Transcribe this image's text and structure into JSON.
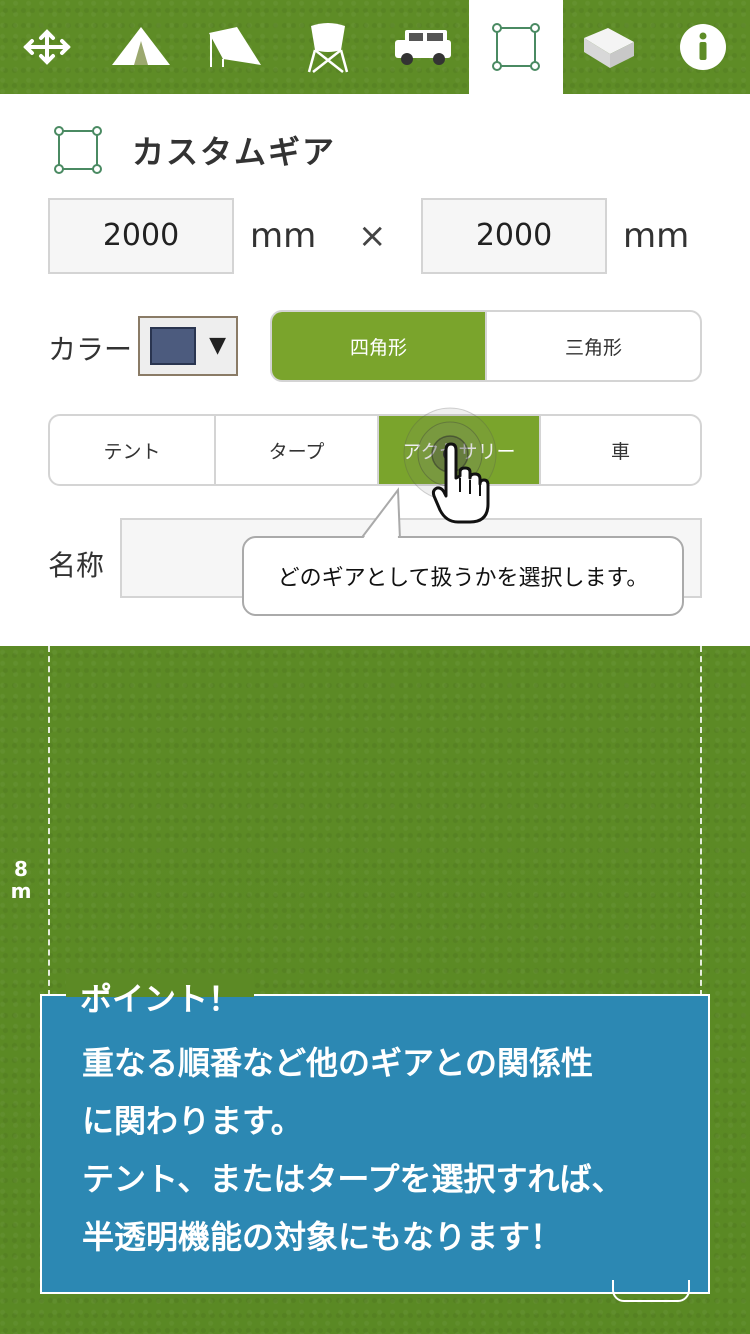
{
  "toolbar": {
    "items": [
      {
        "icon": "move-arrows-icon",
        "active": false
      },
      {
        "icon": "tent-icon",
        "active": false
      },
      {
        "icon": "tarp-icon",
        "active": false
      },
      {
        "icon": "camp-chair-icon",
        "active": false
      },
      {
        "icon": "car-icon",
        "active": false
      },
      {
        "icon": "custom-square-icon",
        "active": true
      },
      {
        "icon": "cooler-box-icon",
        "active": false
      },
      {
        "icon": "info-icon",
        "active": false
      }
    ]
  },
  "panel": {
    "title": "カスタムギア",
    "width_value": "2000",
    "height_value": "2000",
    "unit": "mm",
    "times": "×",
    "color_label": "カラー",
    "color_value": "#4c5b7e",
    "caret": "▼",
    "shape_options": [
      "四角形",
      "三角形"
    ],
    "shape_selected": 0,
    "category_options": [
      "テント",
      "タープ",
      "アクセサリー",
      "車"
    ],
    "category_selected": 2,
    "name_label": "名称",
    "name_value": ""
  },
  "tooltip": {
    "text": "どのギアとして扱うかを選択します。"
  },
  "ruler": {
    "label": "8\nm"
  },
  "point": {
    "title": "ポイント！",
    "lines": [
      "重なる順番など他のギアとの関係性",
      "に関わります。",
      "テント、またはタープを選択すれば、",
      "半透明機能の対象にもなります！"
    ]
  },
  "colors": {
    "accent": "#7aa42c",
    "info": "#2c88b3",
    "grass": "#5e8c26"
  }
}
